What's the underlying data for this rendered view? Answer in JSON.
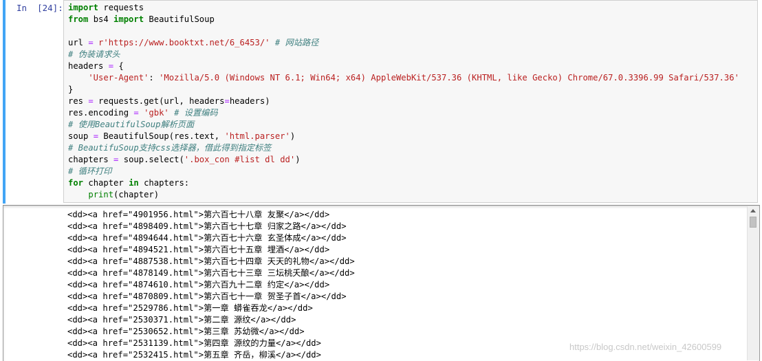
{
  "cell": {
    "prompt": "In  [24]:",
    "code_lines": [
      [
        {
          "t": "import",
          "c": "kw"
        },
        {
          "t": " requests",
          "c": ""
        }
      ],
      [
        {
          "t": "from",
          "c": "kw"
        },
        {
          "t": " bs4 ",
          "c": ""
        },
        {
          "t": "import",
          "c": "kw"
        },
        {
          "t": " BeautifulSoup",
          "c": ""
        }
      ],
      [
        {
          "t": "",
          "c": ""
        }
      ],
      [
        {
          "t": "url ",
          "c": ""
        },
        {
          "t": "=",
          "c": "op"
        },
        {
          "t": " r'https://www.booktxt.net/6_6453/'",
          "c": "str"
        },
        {
          "t": " # 网站路径",
          "c": "cm"
        }
      ],
      [
        {
          "t": "# 伪装请求头",
          "c": "cm"
        }
      ],
      [
        {
          "t": "headers ",
          "c": ""
        },
        {
          "t": "=",
          "c": "op"
        },
        {
          "t": " {",
          "c": ""
        }
      ],
      [
        {
          "t": "    'User-Agent'",
          "c": "str"
        },
        {
          "t": ": ",
          "c": ""
        },
        {
          "t": "'Mozilla/5.0 (Windows NT 6.1; Win64; x64) AppleWebKit/537.36 (KHTML, like Gecko) Chrome/67.0.3396.99 Safari/537.36'",
          "c": "str"
        }
      ],
      [
        {
          "t": "}",
          "c": ""
        }
      ],
      [
        {
          "t": "res ",
          "c": ""
        },
        {
          "t": "=",
          "c": "op"
        },
        {
          "t": " requests.get(url, headers",
          "c": ""
        },
        {
          "t": "=",
          "c": "op"
        },
        {
          "t": "headers)",
          "c": ""
        }
      ],
      [
        {
          "t": "res.encoding ",
          "c": ""
        },
        {
          "t": "=",
          "c": "op"
        },
        {
          "t": " 'gbk'",
          "c": "str"
        },
        {
          "t": " # 设置编码",
          "c": "cm"
        }
      ],
      [
        {
          "t": "# 使用BeautifulSoup解析页面",
          "c": "cm"
        }
      ],
      [
        {
          "t": "soup ",
          "c": ""
        },
        {
          "t": "=",
          "c": "op"
        },
        {
          "t": " BeautifulSoup(res.text, ",
          "c": ""
        },
        {
          "t": "'html.parser'",
          "c": "str"
        },
        {
          "t": ")",
          "c": ""
        }
      ],
      [
        {
          "t": "# BeautifuSoup支持css选择器，借此得到指定标签",
          "c": "cm"
        }
      ],
      [
        {
          "t": "chapters ",
          "c": ""
        },
        {
          "t": "=",
          "c": "op"
        },
        {
          "t": " soup.select(",
          "c": ""
        },
        {
          "t": "'.box_con #list dl dd'",
          "c": "str"
        },
        {
          "t": ")",
          "c": ""
        }
      ],
      [
        {
          "t": "# 循环打印",
          "c": "cm"
        }
      ],
      [
        {
          "t": "for",
          "c": "kw"
        },
        {
          "t": " chapter ",
          "c": ""
        },
        {
          "t": "in",
          "c": "kw"
        },
        {
          "t": " chapters:",
          "c": ""
        }
      ],
      [
        {
          "t": "    ",
          "c": ""
        },
        {
          "t": "print",
          "c": "fn"
        },
        {
          "t": "(chapter)",
          "c": ""
        }
      ]
    ]
  },
  "output": {
    "lines": [
      "<dd><a href=\"4901956.html\">第六百七十八章 友聚</a></dd>",
      "<dd><a href=\"4898409.html\">第六百七十七章 归家之路</a></dd>",
      "<dd><a href=\"4894644.html\">第六百七十六章 玄圣体成</a></dd>",
      "<dd><a href=\"4894521.html\">第六百七十五章 埋酒</a></dd>",
      "<dd><a href=\"4887538.html\">第六百七十四章 天天的礼物</a></dd>",
      "<dd><a href=\"4878149.html\">第六百七十三章 三坛桃夭酿</a></dd>",
      "<dd><a href=\"4874610.html\">第六百九十二章 约定</a></dd>",
      "<dd><a href=\"4870809.html\">第六百七十一章 贺圣子首</a></dd>",
      "<dd><a href=\"2529786.html\">第一章 蟒雀吞龙</a></dd>",
      "<dd><a href=\"2530371.html\">第二章 源纹</a></dd>",
      "<dd><a href=\"2530652.html\">第三章 苏幼微</a></dd>",
      "<dd><a href=\"2531139.html\">第四章 源纹的力量</a></dd>",
      "<dd><a href=\"2532415.html\">第五章 齐岳，柳溪</a></dd>"
    ]
  },
  "watermark": "https://blog.csdn.net/weixin_42600599"
}
